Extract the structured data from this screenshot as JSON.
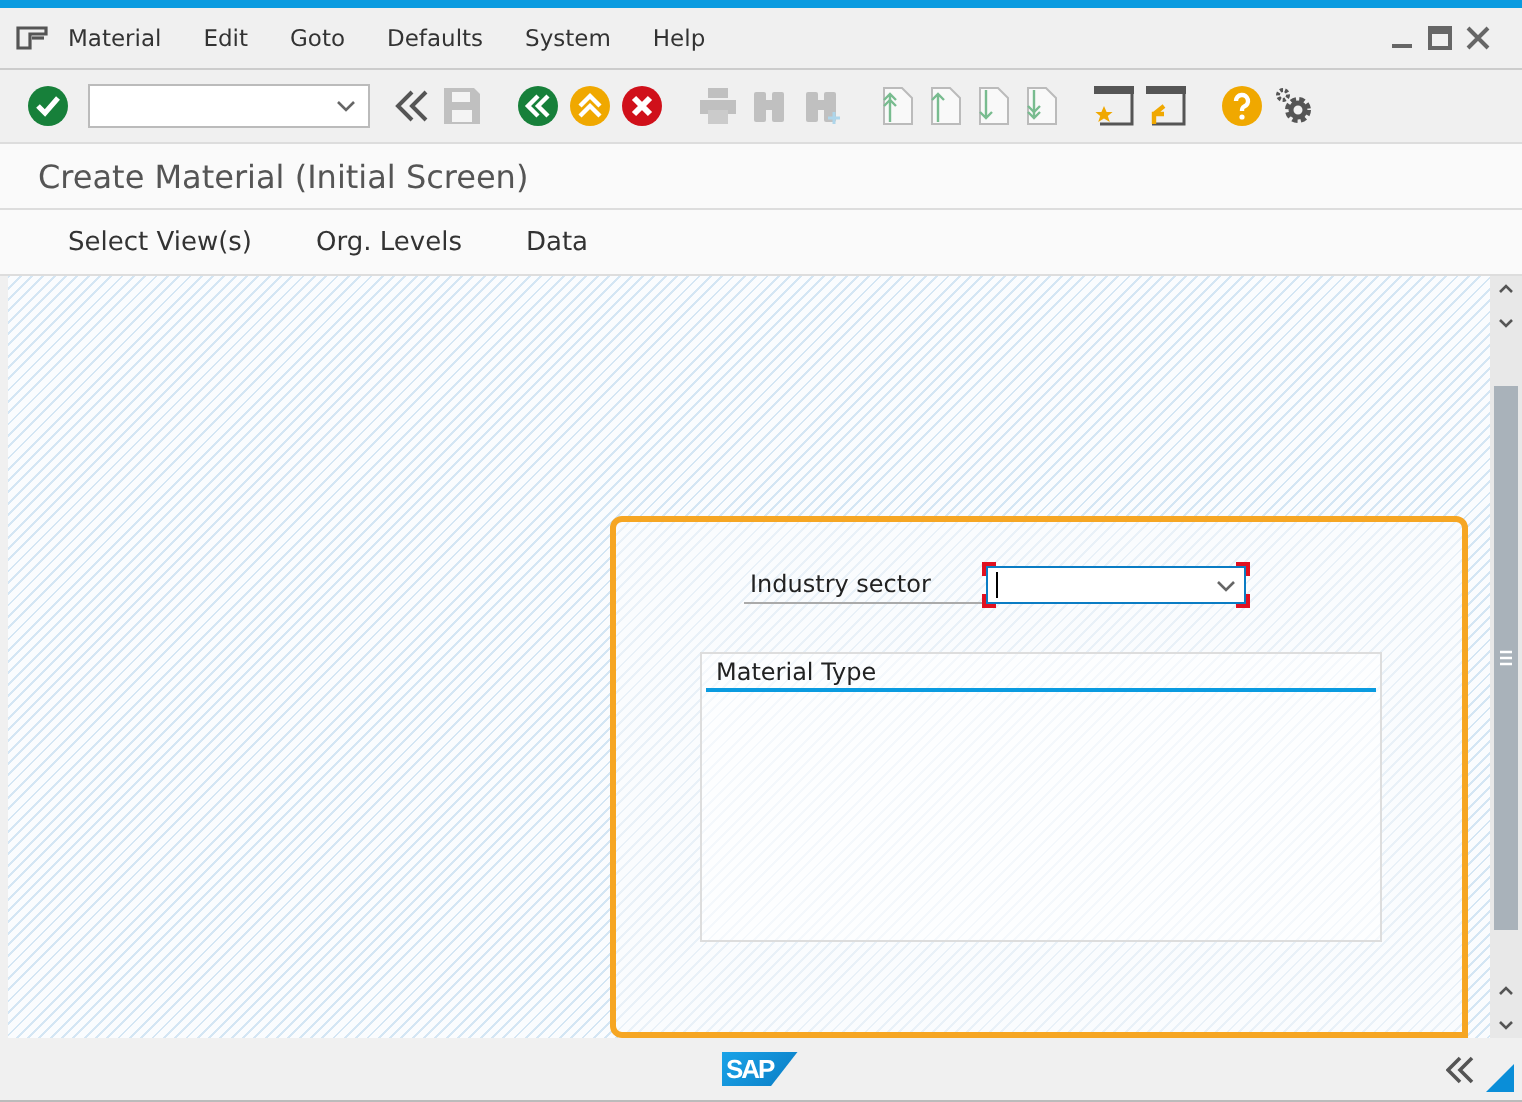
{
  "menu": [
    {
      "label": "Material"
    },
    {
      "label": "Edit"
    },
    {
      "label": "Goto"
    },
    {
      "label": "Defaults"
    },
    {
      "label": "System"
    },
    {
      "label": "Help"
    }
  ],
  "toolbar": [
    {
      "items": [
        {
          "kind": "enter",
          "disabled": false
        },
        {
          "kind": "command-field",
          "disabled": false
        },
        {
          "kind": "collapse",
          "disabled": false
        },
        {
          "kind": "save",
          "disabled": true
        }
      ]
    },
    {
      "items": [
        {
          "kind": "back",
          "disabled": false
        },
        {
          "kind": "exit",
          "disabled": false
        },
        {
          "kind": "cancel",
          "disabled": false
        }
      ]
    },
    {
      "items": [
        {
          "kind": "print",
          "disabled": true
        },
        {
          "kind": "find",
          "disabled": true
        },
        {
          "kind": "find-next",
          "disabled": true
        }
      ]
    },
    {
      "items": [
        {
          "kind": "first-page",
          "disabled": true
        },
        {
          "kind": "prev-page",
          "disabled": true
        },
        {
          "kind": "next-page",
          "disabled": true
        },
        {
          "kind": "last-page",
          "disabled": true
        }
      ]
    },
    {
      "items": [
        {
          "kind": "new-session",
          "disabled": false
        },
        {
          "kind": "shortcut",
          "disabled": false
        }
      ]
    },
    {
      "items": [
        {
          "kind": "help",
          "disabled": false
        },
        {
          "kind": "settings",
          "disabled": false
        }
      ]
    }
  ],
  "title": "Create Material (Initial Screen)",
  "app_toolbar": [
    {
      "label": "Select View(s)"
    },
    {
      "label": "Org. Levels"
    },
    {
      "label": "Data"
    }
  ],
  "form": {
    "industry_sector": {
      "label": "Industry sector",
      "focused": true
    },
    "material_type": {
      "title": "Material Type"
    }
  },
  "footer": {
    "logo": "SAP"
  }
}
